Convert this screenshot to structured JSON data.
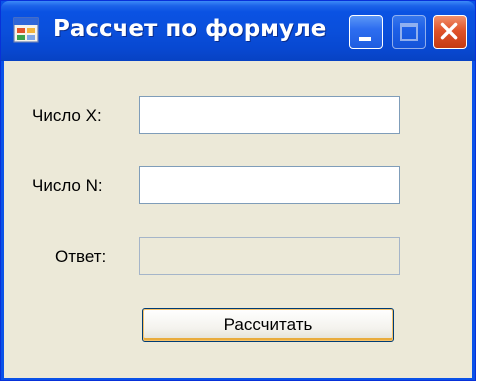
{
  "window": {
    "title": "Рассчет по формуле",
    "icon": "form-app-icon",
    "controls": [
      "minimize-icon",
      "maximize-icon",
      "close-icon"
    ]
  },
  "form": {
    "x_label": "Число X:",
    "x_value": "",
    "n_label": "Число N:",
    "n_value": "",
    "answer_label": "Ответ:",
    "answer_value": "",
    "calculate_button": "Рассчитать"
  },
  "colors": {
    "titlebar": "#0a52e3",
    "client_background": "#ece9d8",
    "close_button": "#e0532a"
  }
}
